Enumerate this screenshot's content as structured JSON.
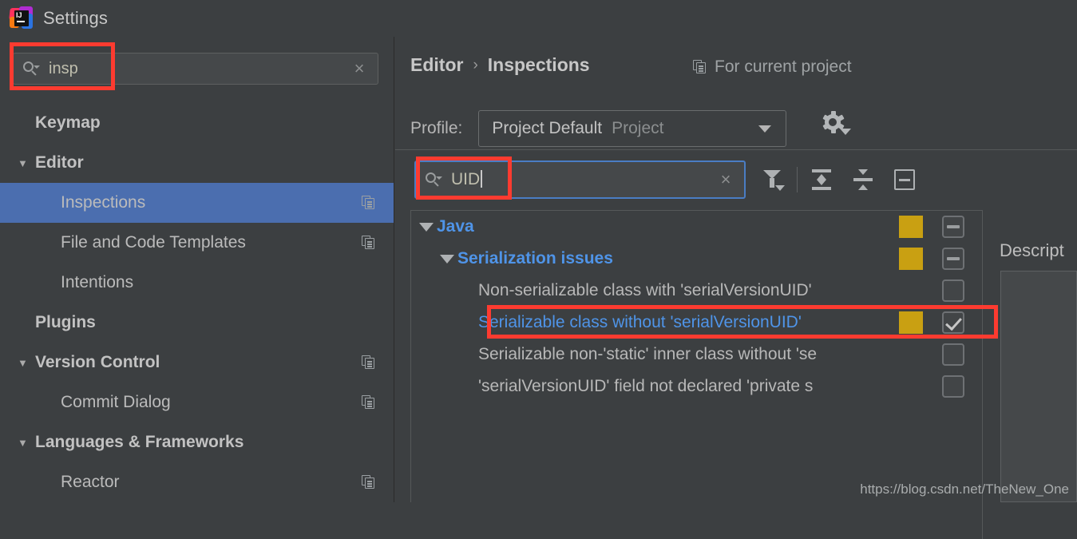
{
  "window": {
    "title": "Settings",
    "logo_icon": "intellij-idea-logo-icon"
  },
  "left_search": {
    "value": "insp",
    "placeholder": "",
    "search_icon": "search-icon",
    "clear_icon": "close-icon",
    "clear_glyph": "×"
  },
  "sidebar": {
    "items": [
      {
        "label": "Keymap",
        "level": 0,
        "bold": true,
        "arrow": "",
        "copy": false,
        "selected": false
      },
      {
        "label": "Editor",
        "level": 0,
        "bold": true,
        "arrow": "▼",
        "copy": false,
        "selected": false
      },
      {
        "label": "Inspections",
        "level": 1,
        "bold": false,
        "arrow": "",
        "copy": true,
        "selected": true
      },
      {
        "label": "File and Code Templates",
        "level": 1,
        "bold": false,
        "arrow": "",
        "copy": true,
        "selected": false
      },
      {
        "label": "Intentions",
        "level": 1,
        "bold": false,
        "arrow": "",
        "copy": false,
        "selected": false
      },
      {
        "label": "Plugins",
        "level": 0,
        "bold": true,
        "arrow": "",
        "copy": false,
        "selected": false
      },
      {
        "label": "Version Control",
        "level": 0,
        "bold": true,
        "arrow": "▼",
        "copy": true,
        "selected": false
      },
      {
        "label": "Commit Dialog",
        "level": 1,
        "bold": false,
        "arrow": "",
        "copy": true,
        "selected": false
      },
      {
        "label": "Languages & Frameworks",
        "level": 0,
        "bold": true,
        "arrow": "▼",
        "copy": false,
        "selected": false
      },
      {
        "label": "Reactor",
        "level": 1,
        "bold": false,
        "arrow": "",
        "copy": true,
        "selected": false
      }
    ]
  },
  "content": {
    "breadcrumb": {
      "parent": "Editor",
      "separator": "›",
      "current": "Inspections"
    },
    "for_current_project": {
      "label": "For current project",
      "icon": "copy-icon"
    },
    "profile": {
      "label": "Profile:",
      "value": "Project Default",
      "scope": "Project",
      "dropdown_icon": "chevron-down-icon",
      "gear_icon": "gear-icon"
    },
    "tree_search": {
      "value": "UID",
      "placeholder": "",
      "search_icon": "search-icon",
      "clear_icon": "close-icon",
      "clear_glyph": "×"
    },
    "toolbar": [
      {
        "name": "filter-icon",
        "tooltip": "Filter Inspections"
      },
      {
        "name": "expand-all-icon",
        "tooltip": "Expand All"
      },
      {
        "name": "collapse-all-icon",
        "tooltip": "Collapse All"
      },
      {
        "name": "reset-icon",
        "tooltip": "Reset"
      }
    ],
    "tree": [
      {
        "label": "Java",
        "type": "group",
        "indent": 0,
        "arrow": "▼",
        "severity": true,
        "check": "dash",
        "selected": false
      },
      {
        "label": "Serialization issues",
        "type": "group",
        "indent": 1,
        "arrow": "▼",
        "severity": true,
        "check": "dash",
        "selected": false
      },
      {
        "label": "Non-serializable class with 'serialVersionUID'",
        "type": "item",
        "indent": 2,
        "arrow": "",
        "severity": false,
        "check": "empty",
        "selected": false
      },
      {
        "label": "Serializable class without 'serialVersionUID'",
        "type": "item",
        "indent": 2,
        "arrow": "",
        "severity": true,
        "check": "tick",
        "selected": true
      },
      {
        "label": "Serializable non-'static' inner class without 'se",
        "type": "item",
        "indent": 2,
        "arrow": "",
        "severity": false,
        "check": "empty",
        "selected": false
      },
      {
        "label": "'serialVersionUID' field not declared 'private s",
        "type": "item",
        "indent": 2,
        "arrow": "",
        "severity": false,
        "check": "empty",
        "selected": false
      }
    ],
    "description": {
      "title": "Descript"
    }
  },
  "watermark": "https://blog.csdn.net/TheNew_One",
  "colors": {
    "background": "#3c3f41",
    "selection_blue": "#4b6eaf",
    "link_blue": "#4f94e8",
    "severity_yellow": "#c9a012",
    "highlight_red": "#fd3b30",
    "field_background": "#45484a",
    "focus_border": "#4a7dc4"
  }
}
